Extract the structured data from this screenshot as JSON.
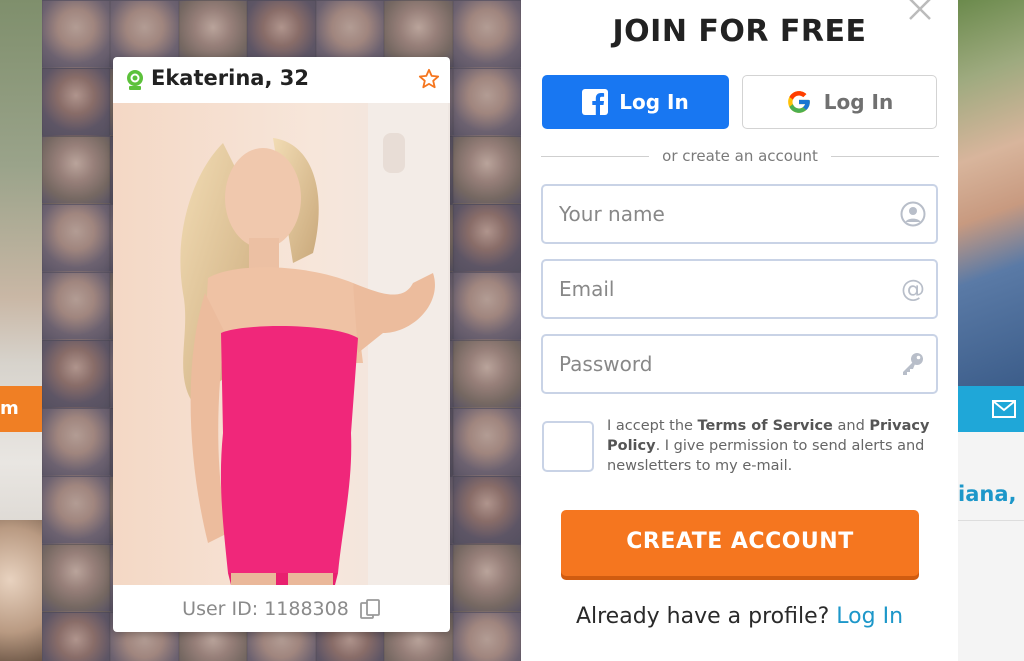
{
  "background": {
    "left_button_fragment": "m",
    "right_name_fragment": "iana, ",
    "right_icon": "mail-icon"
  },
  "profile_card": {
    "name": "Ekaterina, 32",
    "user_id": "User ID: 1188308",
    "online_icon": "webcam-icon",
    "favorite_icon": "star-icon",
    "copy_icon": "copy-icon"
  },
  "signup": {
    "title": "JOIN FOR FREE",
    "facebook_label": "Log In",
    "google_label": "Log In",
    "divider_text": "or create an account",
    "name_placeholder": "Your name",
    "email_placeholder": "Email",
    "password_placeholder": "Password",
    "consent": {
      "prefix": "I accept the ",
      "terms": "Terms of Service",
      "and": " and ",
      "privacy": "Privacy Policy",
      "suffix": ". I give permission to send alerts and newsletters to my e-mail."
    },
    "create_label": "CREATE ACCOUNT",
    "already_text": "Already have a profile?",
    "login_link": "Log In"
  },
  "colors": {
    "facebook": "#1877f2",
    "cta": "#f5761f",
    "link": "#1d97c9",
    "field_border": "#c9d3e6"
  }
}
